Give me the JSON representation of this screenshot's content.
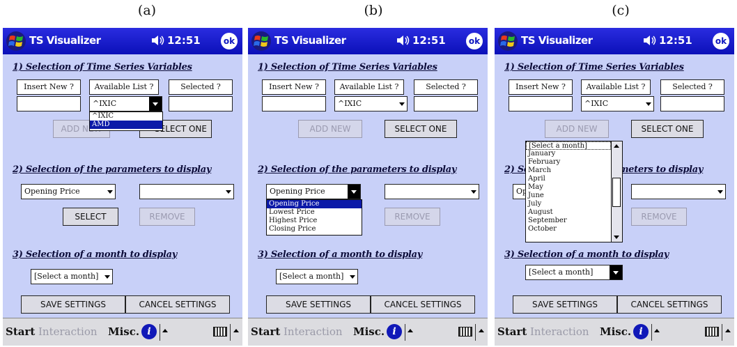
{
  "captions": [
    "(a)",
    "(b)",
    "(c)"
  ],
  "app": {
    "title": "TS Visualizer",
    "time": "12:51",
    "ok_label": "ok"
  },
  "sections": {
    "s1": "1) Selection of Time Series Variables",
    "s2": "2) Selection of the parameters to display",
    "s3": "3) Selection of a month to display"
  },
  "labels": {
    "insert_new": "Insert New ?",
    "available_list": "Available List ?",
    "selected": "Selected ?"
  },
  "available_value": "^IXIC",
  "buttons": {
    "add_new": "ADD NEW",
    "select_one": "SELECT ONE",
    "select": "SELECT",
    "remove": "REMOVE",
    "save_settings": "SAVE SETTINGS",
    "cancel_settings": "CANCEL SETTINGS"
  },
  "param_value": "Opening Price",
  "month_value": "[Select a month]",
  "dropdowns": {
    "available_items": [
      "^IXIC",
      "AMD"
    ],
    "param_items": [
      "Opening Price",
      "Lowest Price",
      "Highest Price",
      "Closing Price"
    ],
    "month_items": [
      "[Select a month]",
      "January",
      "February",
      "March",
      "April",
      "May",
      "June",
      "July",
      "August",
      "September",
      "October"
    ]
  },
  "taskbar": {
    "start": "Start",
    "interaction": "Interaction",
    "misc": "Misc.",
    "info": "i"
  },
  "colors": {
    "titlebar": "#0b10b8",
    "content": "#c8d0f8",
    "selection": "#0c1aa8"
  }
}
